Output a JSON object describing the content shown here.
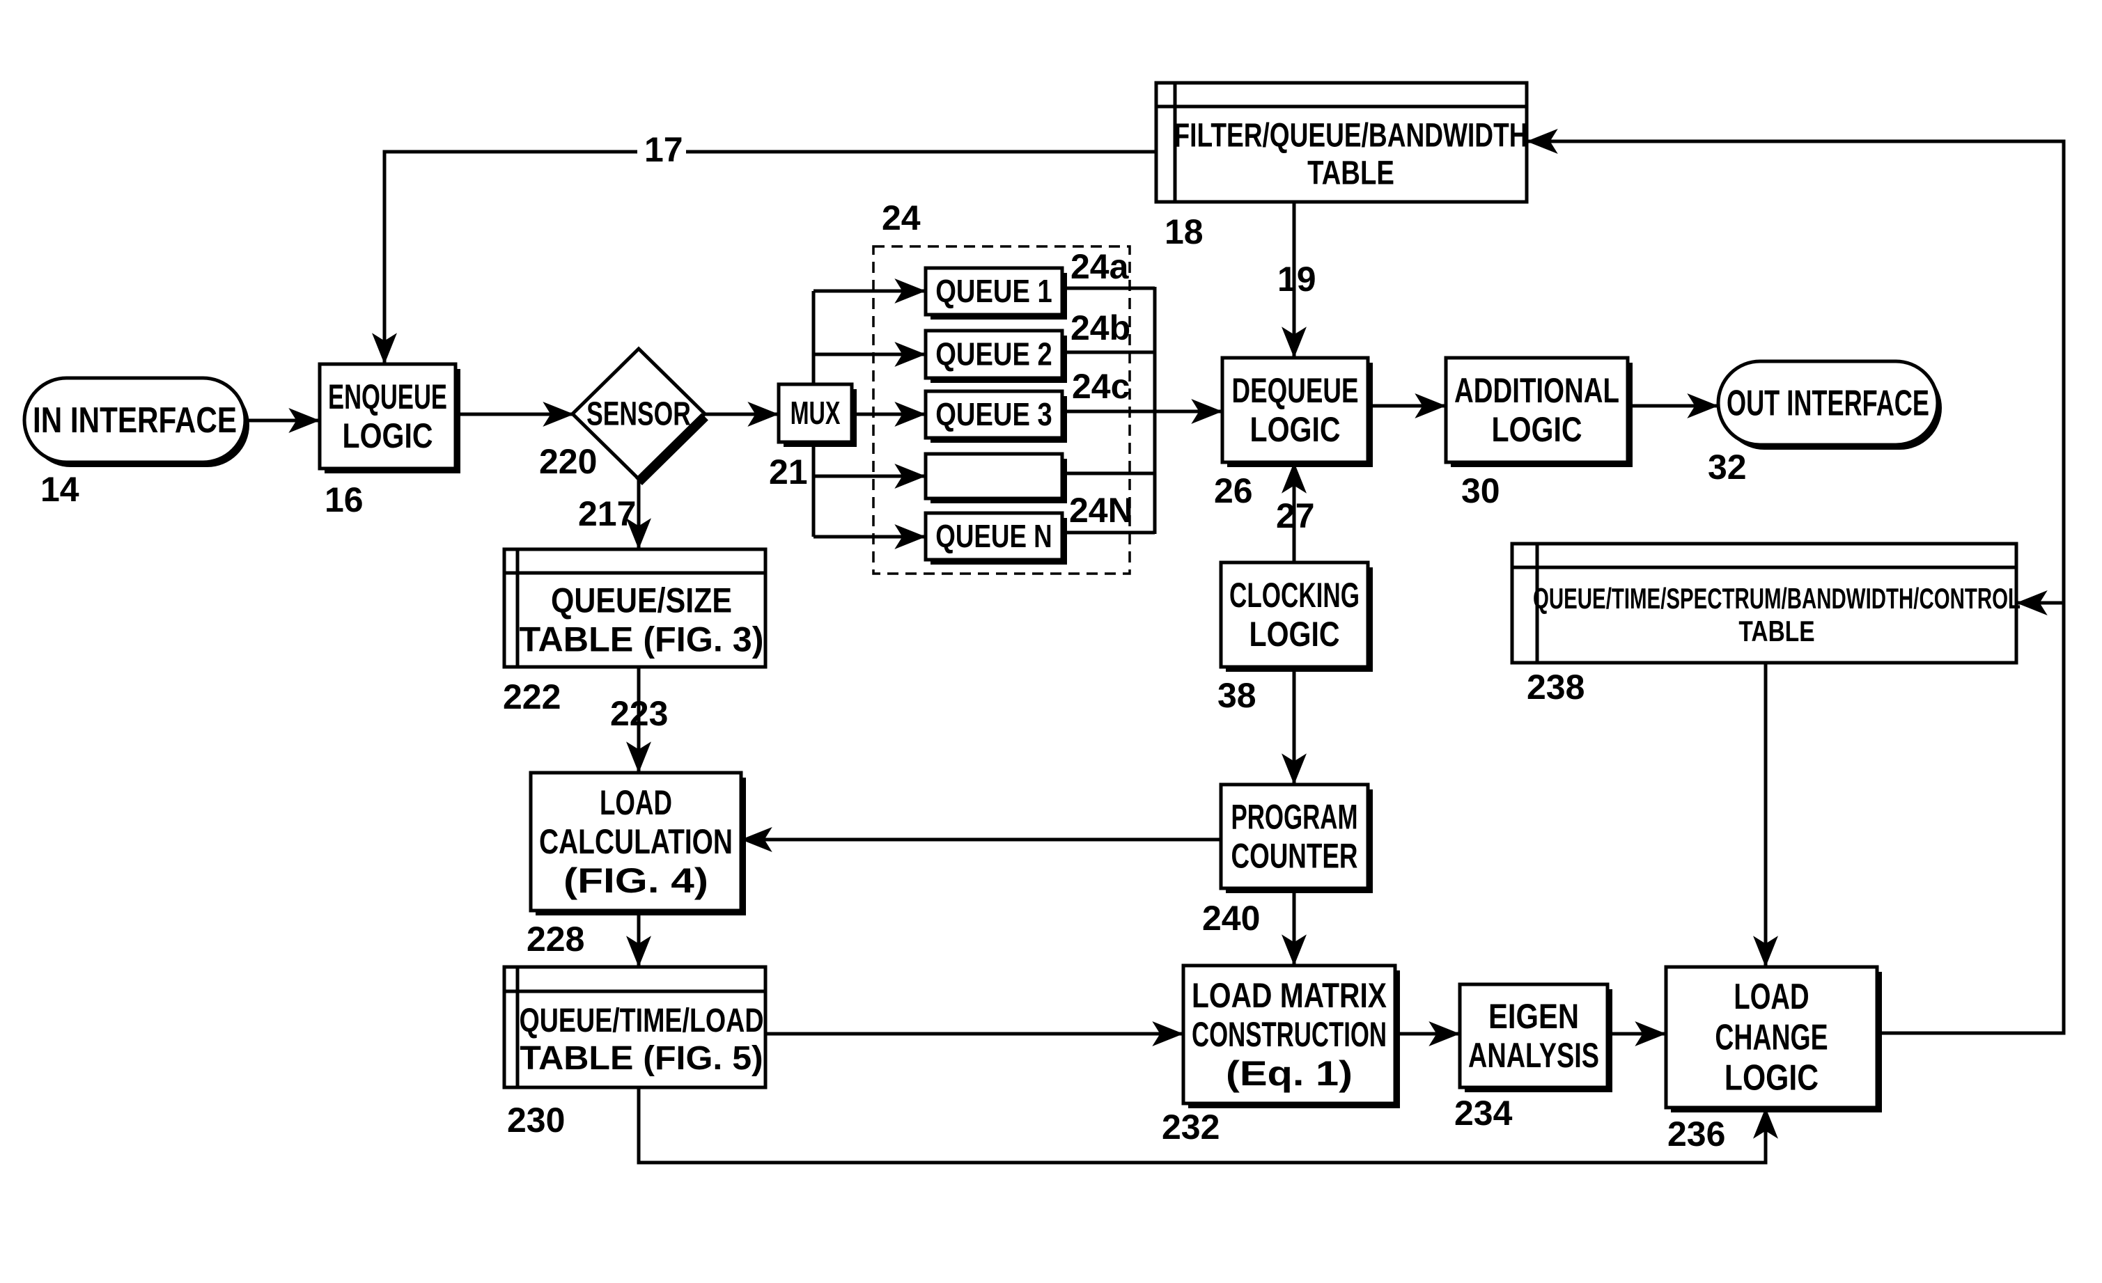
{
  "diagram": {
    "nodes": {
      "in_interface": {
        "lines": [
          "IN INTERFACE"
        ],
        "ref": "14"
      },
      "enqueue_logic": {
        "lines": [
          "ENQUEUE",
          "LOGIC"
        ],
        "ref": "16"
      },
      "sensor": {
        "lines": [
          "SENSOR"
        ],
        "ref": "220"
      },
      "mux": {
        "lines": [
          "MUX"
        ],
        "ref": "21"
      },
      "queue_group": {
        "ref": "24"
      },
      "queue_1": {
        "lines": [
          "QUEUE 1"
        ],
        "ref": "24a"
      },
      "queue_2": {
        "lines": [
          "QUEUE 2"
        ],
        "ref": "24b"
      },
      "queue_3": {
        "lines": [
          "QUEUE 3"
        ],
        "ref": "24c"
      },
      "queue_blank": {
        "lines": [
          ""
        ]
      },
      "queue_n": {
        "lines": [
          "QUEUE N"
        ],
        "ref": "24N"
      },
      "filter_table": {
        "lines": [
          "FILTER/QUEUE/BANDWIDTH",
          "TABLE"
        ],
        "ref": "18"
      },
      "dequeue_logic": {
        "lines": [
          "DEQUEUE",
          "LOGIC"
        ],
        "ref": "26"
      },
      "additional_logic": {
        "lines": [
          "ADDITIONAL",
          "LOGIC"
        ],
        "ref": "30"
      },
      "out_interface": {
        "lines": [
          "OUT INTERFACE"
        ],
        "ref": "32"
      },
      "clocking_logic": {
        "lines": [
          "CLOCKING",
          "LOGIC"
        ],
        "ref": "38"
      },
      "queue_size_table": {
        "lines": [
          "QUEUE/SIZE",
          "TABLE (FIG. 3)"
        ],
        "ref": "222"
      },
      "control_table": {
        "lines": [
          "QUEUE/TIME/SPECTRUM/BANDWIDTH/CONTROL",
          "TABLE"
        ],
        "ref": "238"
      },
      "load_calculation": {
        "lines": [
          "LOAD",
          "CALCULATION",
          "(FIG. 4)"
        ],
        "ref": "228"
      },
      "program_counter": {
        "lines": [
          "PROGRAM",
          "COUNTER"
        ],
        "ref": "240"
      },
      "queue_time_load_table": {
        "lines": [
          "QUEUE/TIME/LOAD",
          "TABLE (FIG. 5)"
        ],
        "ref": "230"
      },
      "load_matrix": {
        "lines": [
          "LOAD MATRIX",
          "CONSTRUCTION",
          "(Eq. 1)"
        ],
        "ref": "232"
      },
      "eigen_analysis": {
        "lines": [
          "EIGEN",
          "ANALYSIS"
        ],
        "ref": "234"
      },
      "load_change_logic": {
        "lines": [
          "LOAD",
          "CHANGE",
          "LOGIC"
        ],
        "ref": "236"
      }
    },
    "edge_labels": {
      "feedback_17": "17",
      "filter_to_dequeue_19": "19",
      "clock_to_dequeue_27": "27",
      "sensor_to_table_217": "217",
      "table_to_calc_223": "223"
    }
  }
}
